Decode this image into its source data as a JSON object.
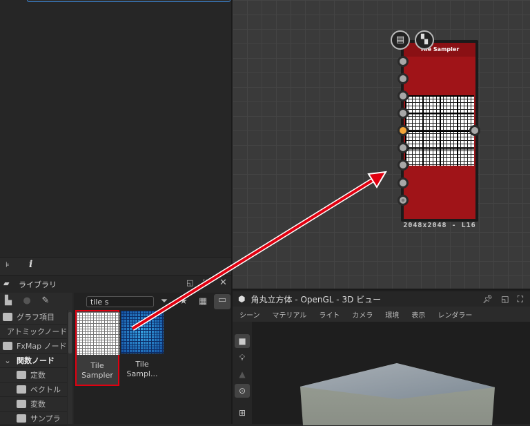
{
  "library": {
    "title": "ライブラリ",
    "search_value": "tile s",
    "categories": [
      {
        "label": "グラフ項目"
      },
      {
        "label": "アトミックノード"
      },
      {
        "label": "FxMap ノード"
      },
      {
        "label": "関数ノード"
      },
      {
        "label": "定数"
      },
      {
        "label": "ベクトル"
      },
      {
        "label": "変数"
      },
      {
        "label": "サンプラ"
      }
    ],
    "results": [
      {
        "label": "Tile Sampler"
      },
      {
        "label": "Tile Sampl..."
      }
    ]
  },
  "node": {
    "title": "Tile Sampler",
    "resolution": "2048x2048 - L16"
  },
  "view3d": {
    "title": "角丸立方体 - OpenGL - 3D ビュー",
    "menu": [
      "シーン",
      "マテリアル",
      "ライト",
      "カメラ",
      "環境",
      "表示",
      "レンダラー"
    ]
  },
  "colors": {
    "node": "#a01418",
    "highlight": "#e00010",
    "port_active": "#f4a63a"
  }
}
